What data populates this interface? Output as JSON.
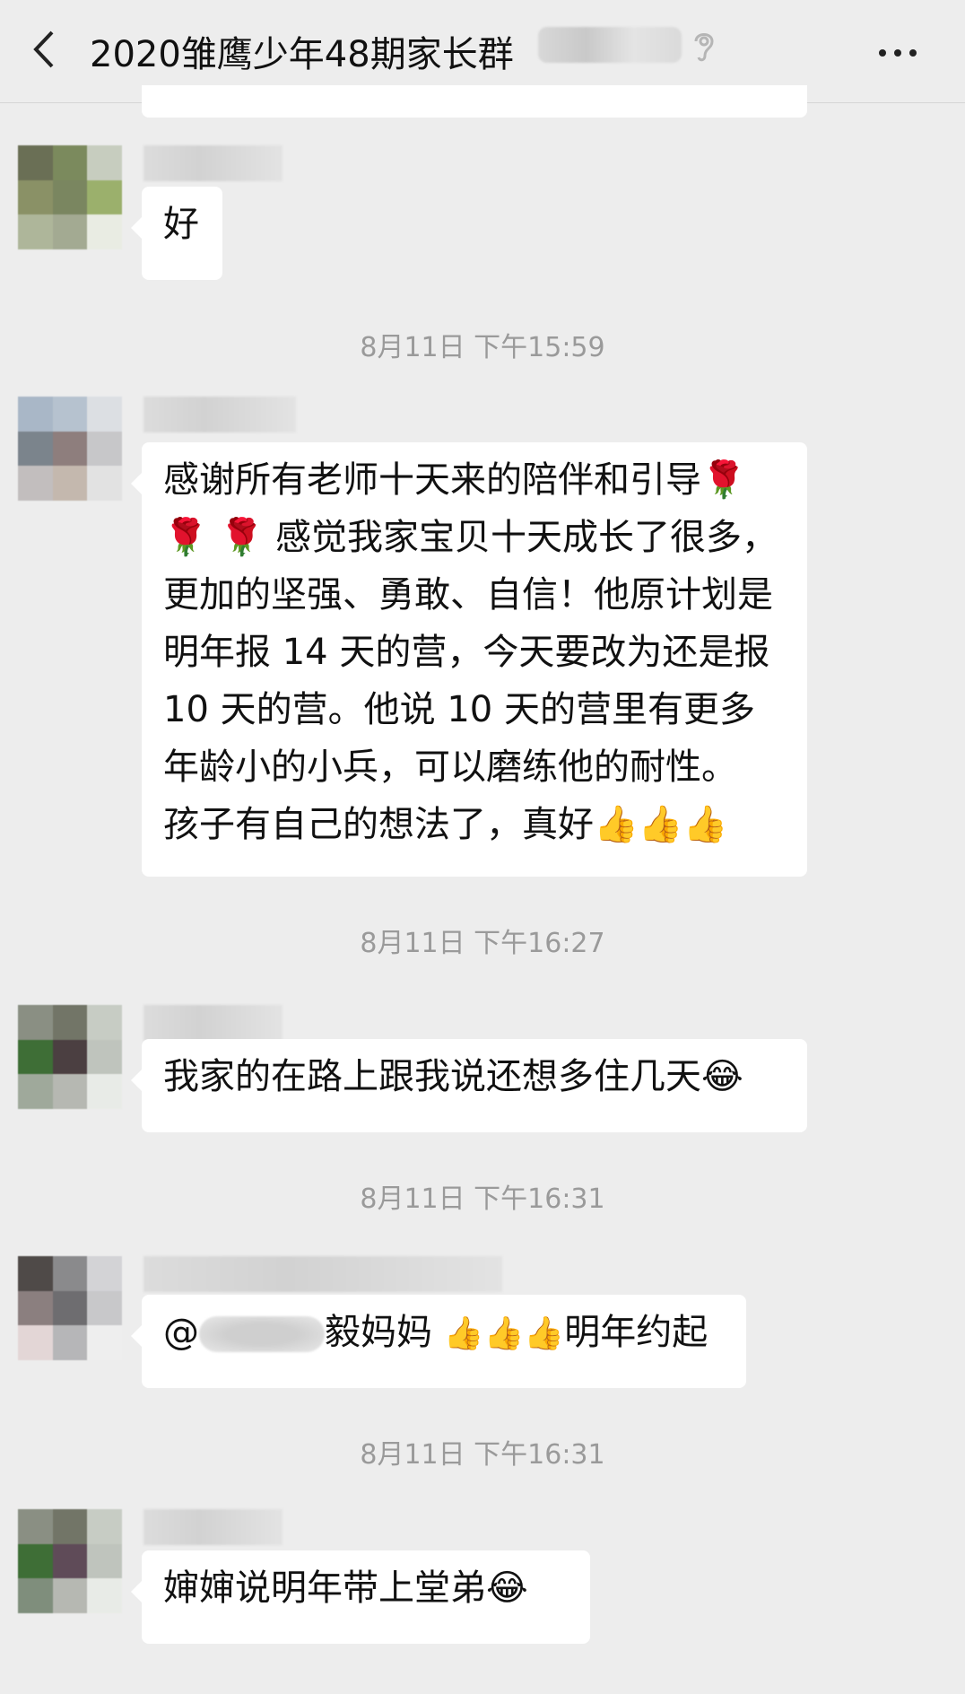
{
  "header": {
    "title": "2020雏鹰少年48期家长群"
  },
  "messages": [
    {
      "id": "m0",
      "text": "好"
    },
    {
      "id": "t1",
      "time": "8月11日 下午15:59"
    },
    {
      "id": "m1",
      "lines": [
        "感谢所有老师十天来的陪伴和引导🌹",
        "🌹 🌹 感觉我家宝贝十天成长了很多，",
        "更加的坚强、勇敢、自信！他原计划是",
        "明年报 14 天的营，今天要改为还是报",
        "10 天的营。他说 10 天的营里有更多",
        "年龄小的小兵，可以磨练他的耐性。",
        "孩子有自己的想法了，真好👍👍👍"
      ]
    },
    {
      "id": "t2",
      "time": "8月11日 下午16:27"
    },
    {
      "id": "m2",
      "text": "我家的在路上跟我说还想多住几天😂"
    },
    {
      "id": "t3",
      "time": "8月11日 下午16:31"
    },
    {
      "id": "m3",
      "prefix": "@",
      "suffix": "毅妈妈 ",
      "emoji": "👍👍👍",
      "tail": "明年约起"
    },
    {
      "id": "t4",
      "time": "8月11日 下午16:31"
    },
    {
      "id": "m4",
      "text": "婶婶说明年带上堂弟😂"
    }
  ],
  "icons": {
    "back": "chevron-left-icon",
    "mute": "ear-mute-icon",
    "more": "more-dots-icon"
  }
}
